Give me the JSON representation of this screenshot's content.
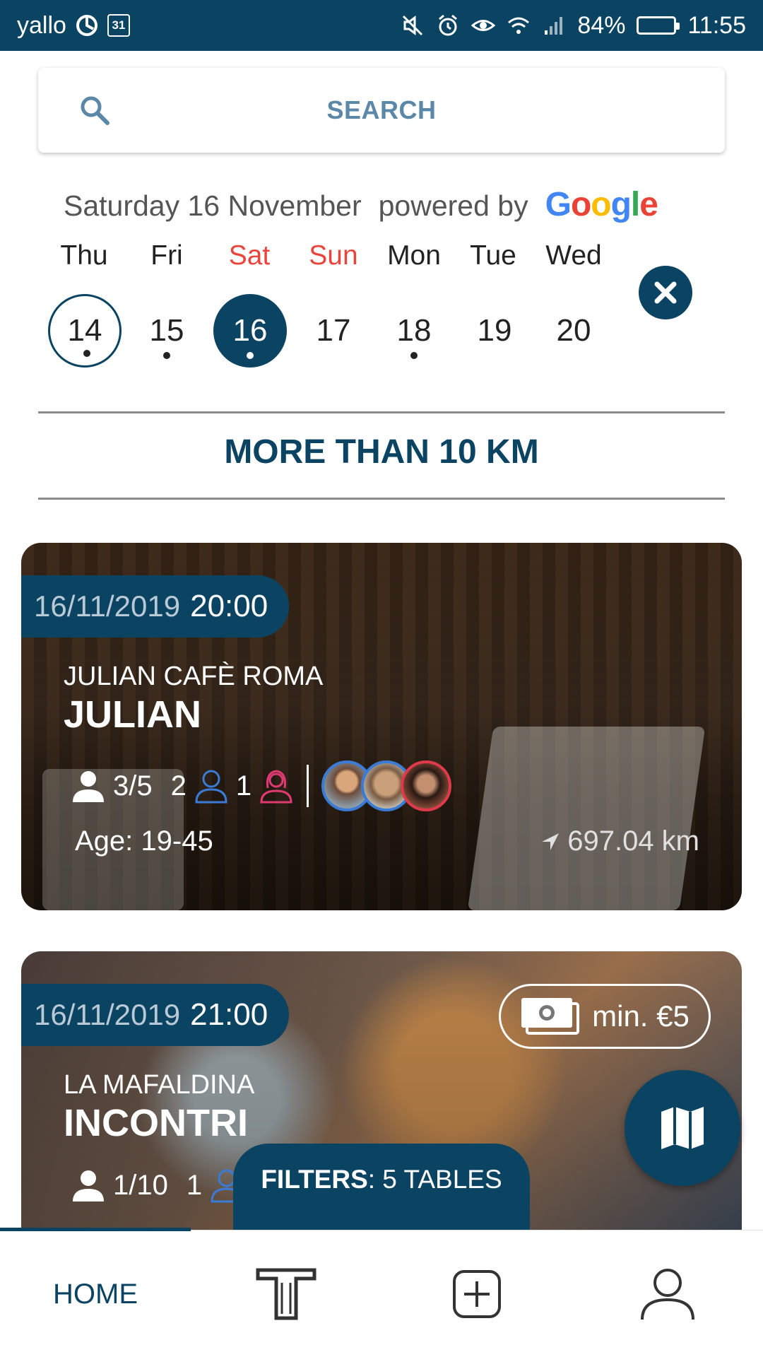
{
  "status_bar": {
    "carrier": "yallo",
    "calendar_day": "31",
    "battery": "84%",
    "time": "11:55",
    "icons": [
      "sync-icon",
      "calendar-icon",
      "mute-icon",
      "alarm-icon",
      "eye-icon",
      "wifi-icon",
      "signal-icon",
      "battery-icon"
    ]
  },
  "search": {
    "label": "SEARCH",
    "icon": "search-icon"
  },
  "date_header": {
    "date_text": "Saturday 16 November",
    "powered_by": "powered by",
    "google": [
      "G",
      "o",
      "o",
      "g",
      "l",
      "e"
    ]
  },
  "calendar": {
    "weekdays": [
      "Thu",
      "Fri",
      "Sat",
      "Sun",
      "Mon",
      "Tue",
      "Wed"
    ],
    "days": [
      "14",
      "15",
      "16",
      "17",
      "18",
      "19",
      "20"
    ],
    "today": "14",
    "selected": "16",
    "days_with_events": [
      "14",
      "15",
      "16",
      "18"
    ]
  },
  "distance_filter": "MORE THAN 10 KM",
  "cards": [
    {
      "date": "16/11/2019",
      "time": "20:00",
      "venue": "JULIAN CAFÈ ROMA",
      "event": "JULIAN",
      "seats": "3/5",
      "male": "2",
      "female": "1",
      "age": "Age: 19-45",
      "distance": "697.04 km"
    },
    {
      "date": "16/11/2019",
      "time": "21:00",
      "venue": "LA MAFALDINA",
      "event": "INCONTRI",
      "seats": "1/10",
      "male": "1",
      "price": "min. €5"
    }
  ],
  "filters": {
    "label": "FILTERS",
    "value": ": 5 TABLES"
  },
  "bottom_nav": {
    "home": "HOME"
  },
  "colors": {
    "primary": "#0b4463",
    "weekend": "#e8453c",
    "male": "#3a7bd5",
    "female": "#e03a72"
  }
}
